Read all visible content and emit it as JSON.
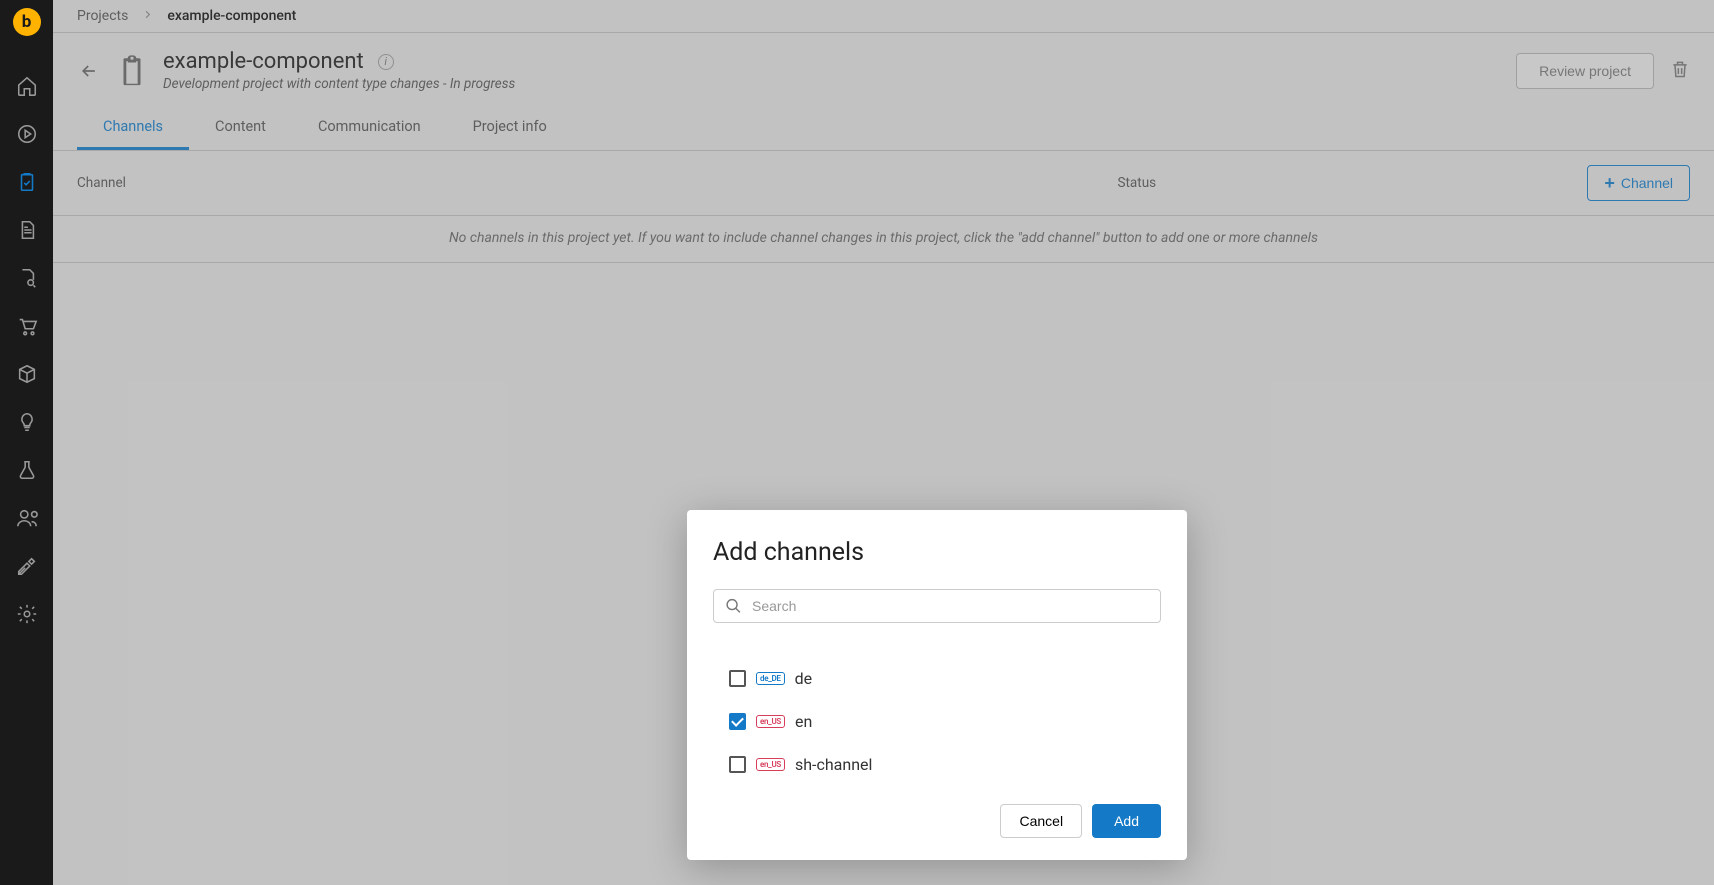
{
  "nav": {
    "logo_letter": "b"
  },
  "breadcrumb": {
    "root": "Projects",
    "current": "example-component"
  },
  "header": {
    "title": "example-component",
    "subtitle_prefix": "Development project with content type changes",
    "subtitle_sep": " -  ",
    "status": "In progress",
    "review_button": "Review project"
  },
  "tabs": [
    {
      "label": "Channels",
      "active": true
    },
    {
      "label": "Content",
      "active": false
    },
    {
      "label": "Communication",
      "active": false
    },
    {
      "label": "Project info",
      "active": false
    }
  ],
  "table": {
    "col_channel": "Channel",
    "col_status": "Status",
    "add_button": "Channel",
    "empty_message": "No channels in this project yet. If you want to include channel changes in this project, click the \"add channel\" button to add one or more channels"
  },
  "modal": {
    "title": "Add channels",
    "search_placeholder": "Search",
    "items": [
      {
        "locale": "de_DE",
        "label": "de",
        "checked": false,
        "tag_style": "blue"
      },
      {
        "locale": "en_US",
        "label": "en",
        "checked": true,
        "tag_style": "red"
      },
      {
        "locale": "en_US",
        "label": "sh-channel",
        "checked": false,
        "tag_style": "red"
      }
    ],
    "cancel": "Cancel",
    "add": "Add"
  }
}
